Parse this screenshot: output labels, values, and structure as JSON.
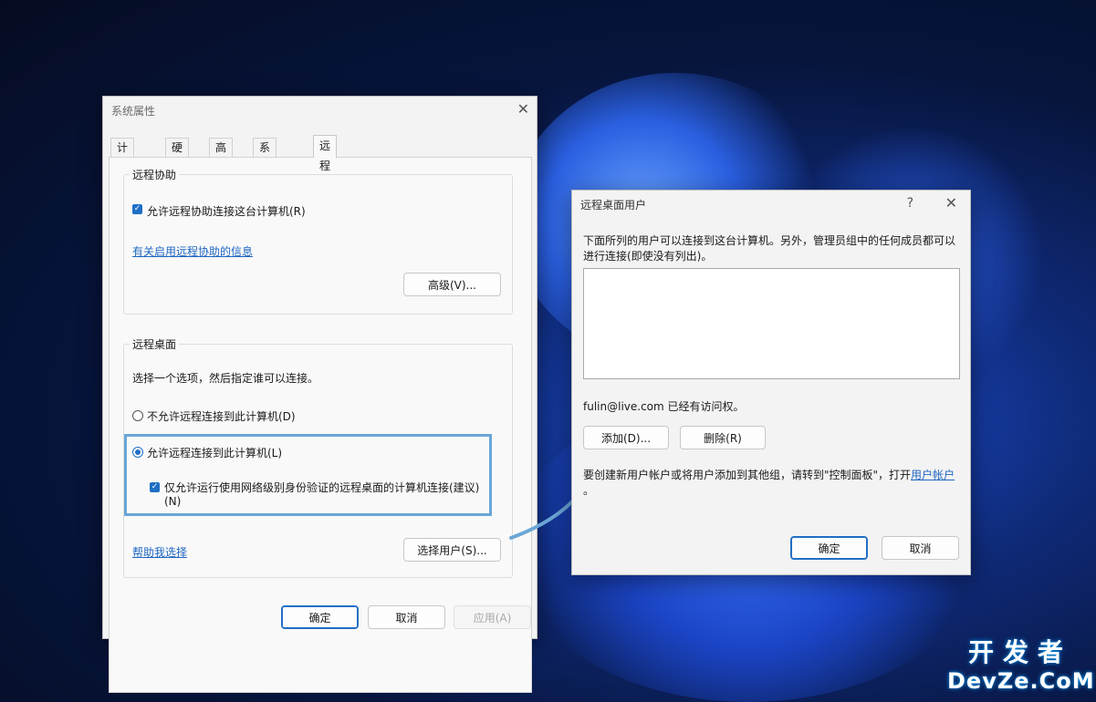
{
  "system_properties": {
    "title": "系统属性",
    "close_glyph": "✕",
    "tabs": [
      "计算机名",
      "硬件",
      "高级",
      "系统保护",
      "远程"
    ],
    "active_tab": "远程",
    "remote_assistance": {
      "group_title": "远程协助",
      "allow_checkbox_label": "允许远程协助连接这台计算机(R)",
      "allow_checked": true,
      "info_link": "有关启用远程协助的信息",
      "advanced_button": "高级(V)..."
    },
    "remote_desktop": {
      "group_title": "远程桌面",
      "instruction": "选择一个选项，然后指定谁可以连接。",
      "option_disallow": "不允许远程连接到此计算机(D)",
      "option_allow": "允许远程连接到此计算机(L)",
      "selected_option": "allow",
      "nla_label_line1": "仅允许运行使用网络级别身份验证的远程桌面的计算机连接(建议)",
      "nla_label_line2": "(N)",
      "nla_checked": true,
      "help_link": "帮助我选择",
      "select_users_button": "选择用户(S)..."
    },
    "ok_button": "确定",
    "cancel_button": "取消",
    "apply_button": "应用(A)"
  },
  "remote_desktop_users": {
    "title": "远程桌面用户",
    "help_glyph": "?",
    "close_glyph": "✕",
    "description_line1": "下面所列的用户可以连接到这台计算机。另外，管理员组中的任何成员都可以",
    "description_line2": "进行连接(即使没有列出)。",
    "users": [],
    "access_note": "fulin@live.com 已经有访问权。",
    "add_button": "添加(D)...",
    "remove_button": "删除(R)",
    "footer_text": "要创建新用户帐户或将用户添加到其他组，请转到\"控制面板\"，打开",
    "footer_link": "用户帐户",
    "footer_end": "。",
    "ok_button": "确定",
    "cancel_button": "取消"
  },
  "watermark": {
    "line1": "开发者",
    "line2": "DevZe.CoM"
  },
  "colors": {
    "accent": "#1f6fc4",
    "highlight_box": "#6ba6d6",
    "link": "#1f66c1"
  }
}
